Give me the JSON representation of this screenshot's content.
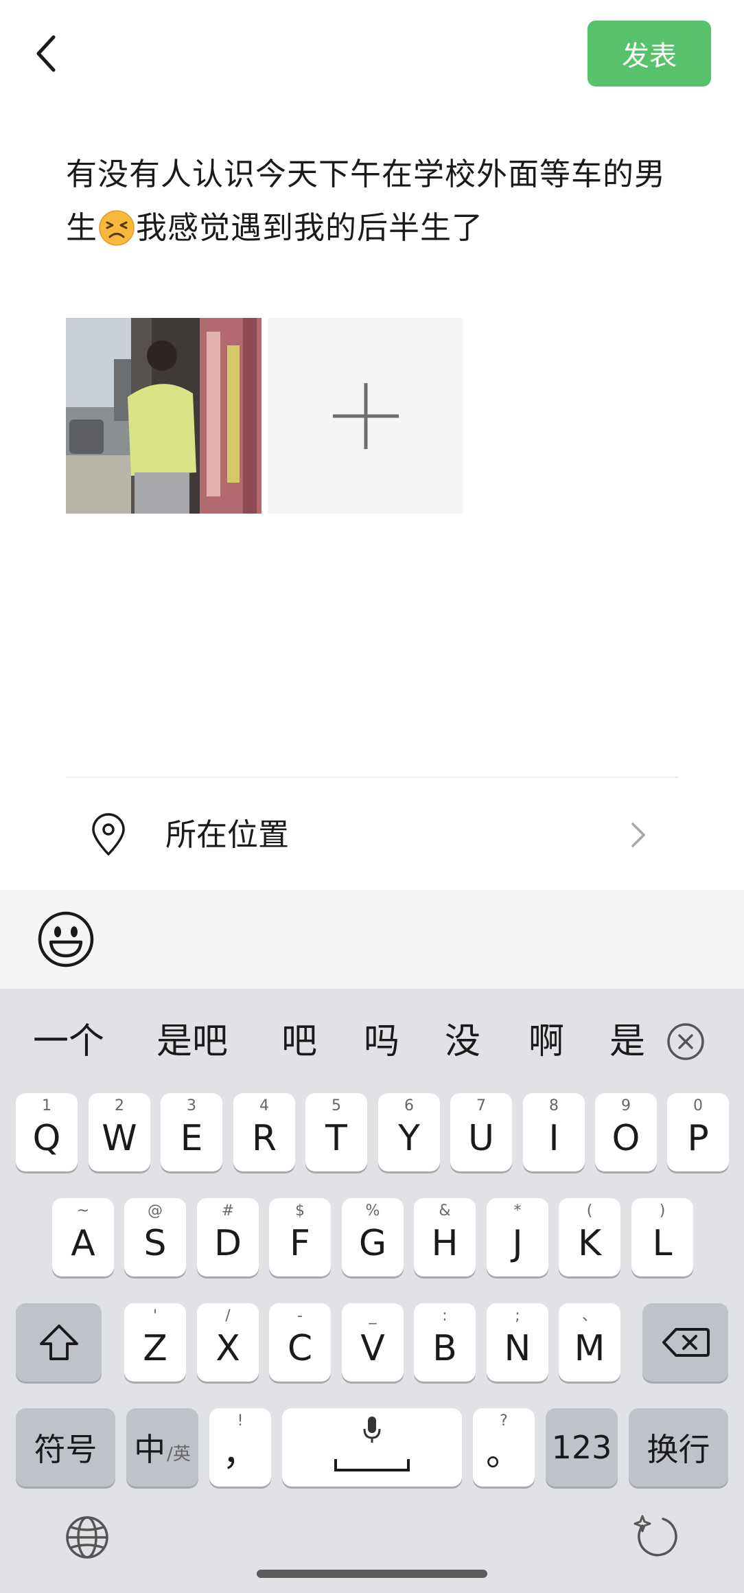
{
  "header": {
    "publish_label": "发表"
  },
  "post": {
    "text_line1": "有没有人认识今天下午在学校外面等车的男",
    "text_line2_start": "生",
    "emoji": "persevering-face",
    "text_line2_end": "我感觉遇到我的后半生了"
  },
  "media": {
    "add_icon": "plus-icon"
  },
  "location": {
    "label": "所在位置"
  },
  "keyboard": {
    "candidates": [
      "一个",
      "是吧",
      "吧",
      "吗",
      "没",
      "啊",
      "是"
    ],
    "rows": [
      [
        {
          "k": "Q",
          "s": "1"
        },
        {
          "k": "W",
          "s": "2"
        },
        {
          "k": "E",
          "s": "3"
        },
        {
          "k": "R",
          "s": "4"
        },
        {
          "k": "T",
          "s": "5"
        },
        {
          "k": "Y",
          "s": "6"
        },
        {
          "k": "U",
          "s": "7"
        },
        {
          "k": "I",
          "s": "8"
        },
        {
          "k": "O",
          "s": "9"
        },
        {
          "k": "P",
          "s": "0"
        }
      ],
      [
        {
          "k": "A",
          "s": "~"
        },
        {
          "k": "S",
          "s": "@"
        },
        {
          "k": "D",
          "s": "#"
        },
        {
          "k": "F",
          "s": "$"
        },
        {
          "k": "G",
          "s": "%"
        },
        {
          "k": "H",
          "s": "&"
        },
        {
          "k": "J",
          "s": "*"
        },
        {
          "k": "K",
          "s": "("
        },
        {
          "k": "L",
          "s": ")"
        }
      ],
      [
        {
          "k": "Z",
          "s": "'"
        },
        {
          "k": "X",
          "s": "/"
        },
        {
          "k": "C",
          "s": "-"
        },
        {
          "k": "V",
          "s": "_"
        },
        {
          "k": "B",
          "s": ":"
        },
        {
          "k": "N",
          "s": ";"
        },
        {
          "k": "M",
          "s": "、"
        }
      ]
    ],
    "symbols_label": "符号",
    "lang_main": "中",
    "lang_alt": "/英",
    "comma_key": "，",
    "comma_sub": "!",
    "period_key": "。",
    "period_sub": "?",
    "numbers_label": "123",
    "enter_label": "换行"
  }
}
